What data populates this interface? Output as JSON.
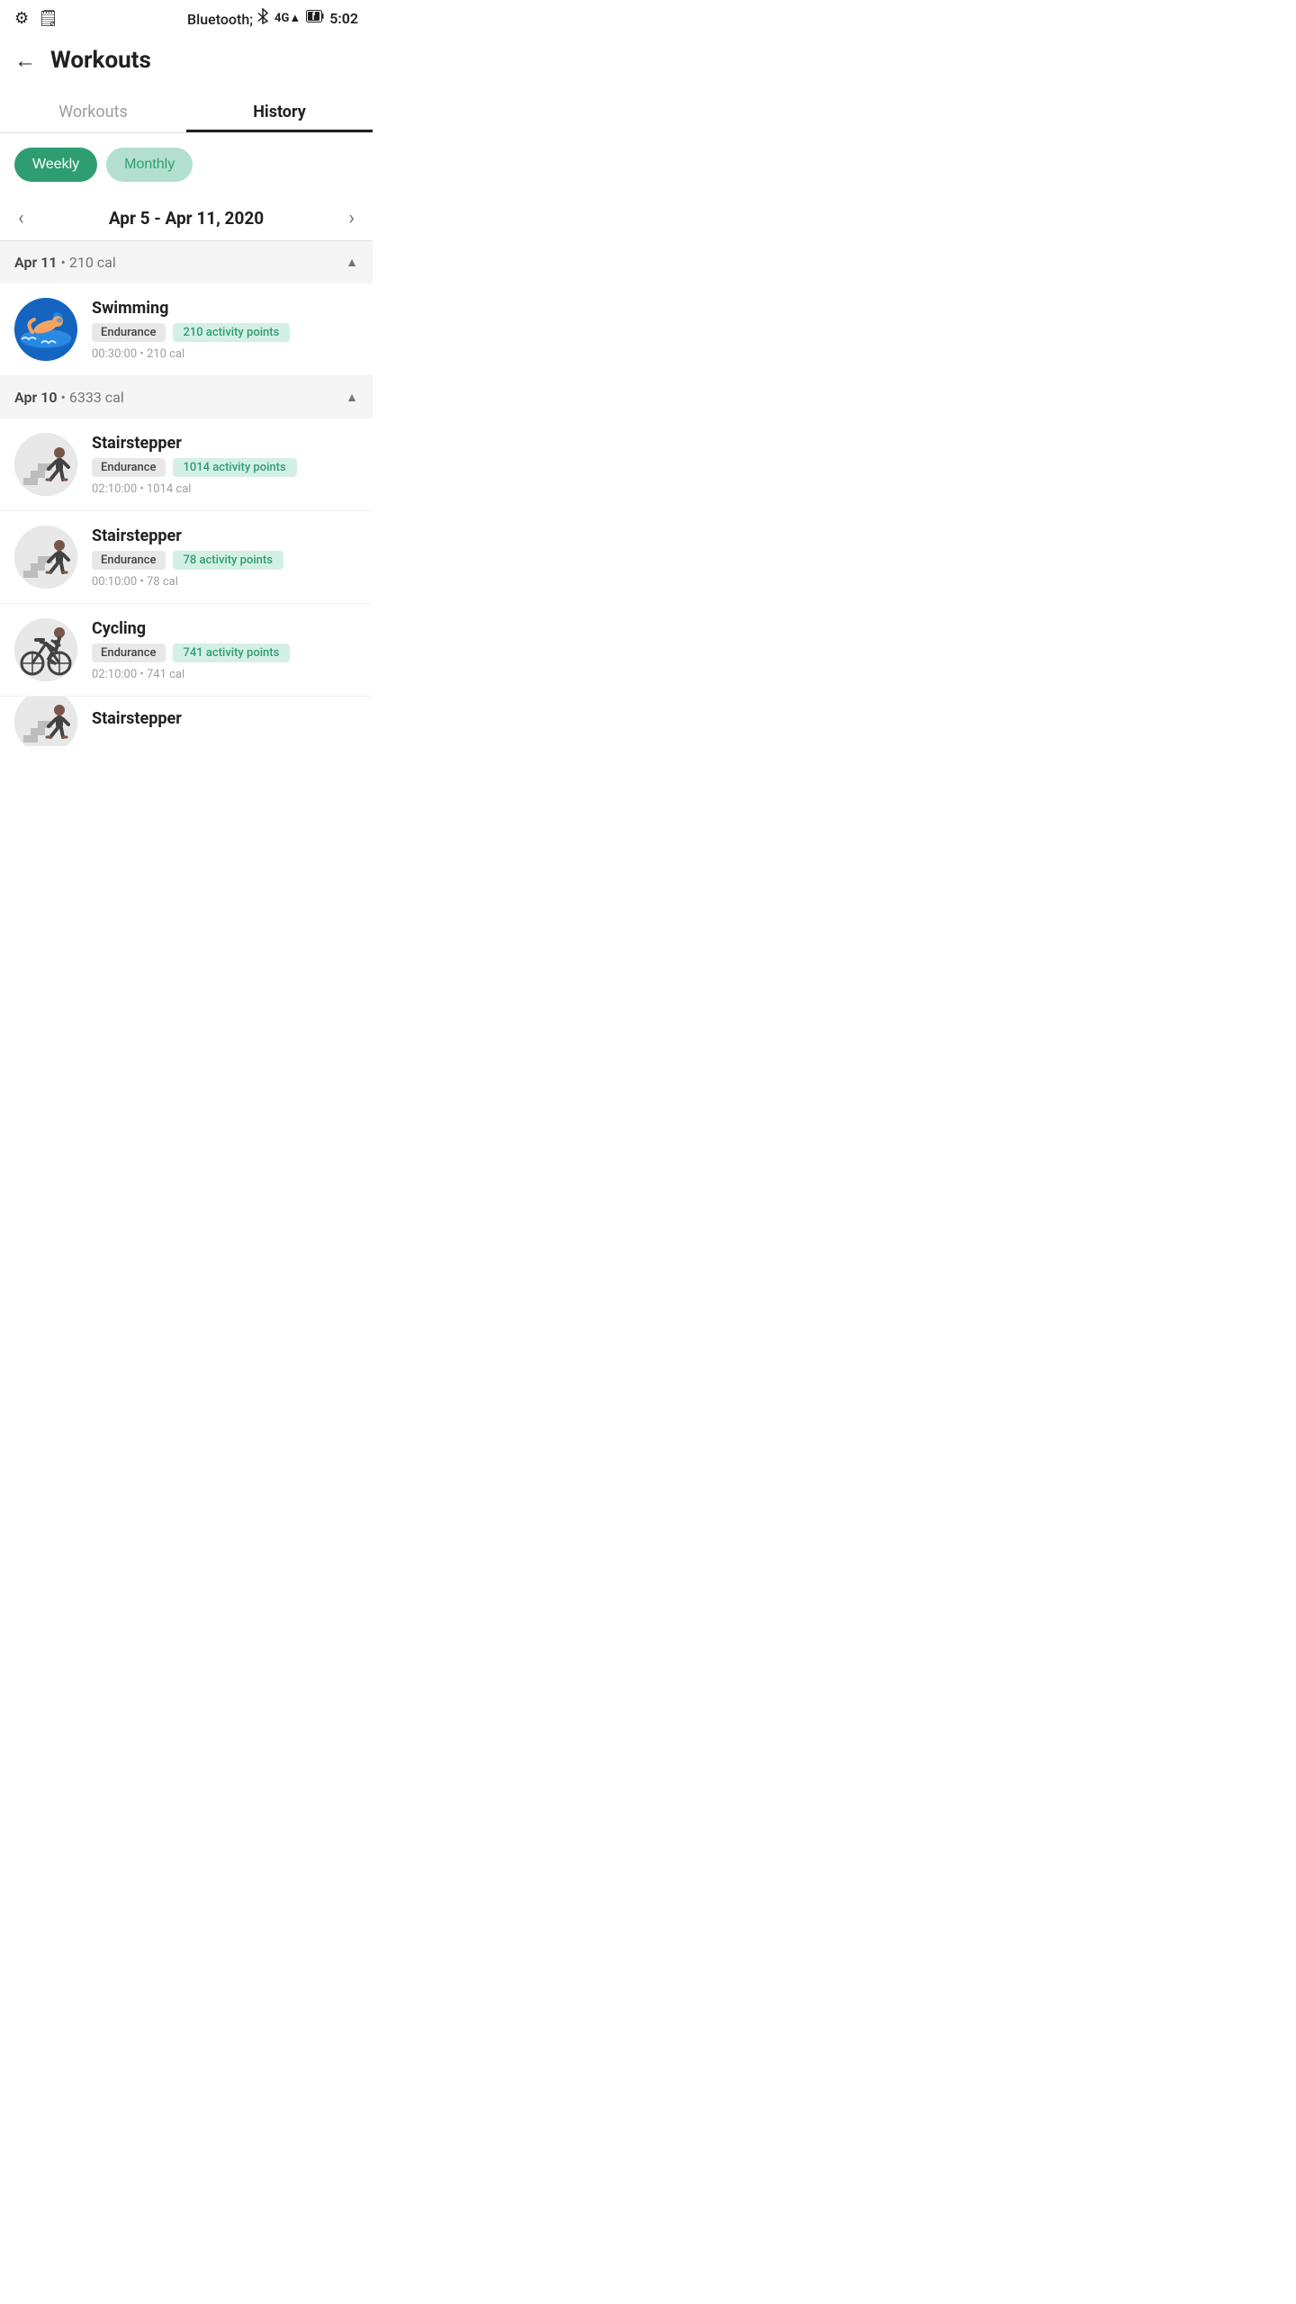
{
  "statusBar": {
    "time": "5:02",
    "icons": {
      "bluetooth": "BT",
      "signal4g": "4G",
      "battery": "⚡"
    }
  },
  "header": {
    "backLabel": "←",
    "title": "Workouts"
  },
  "tabs": [
    {
      "id": "workouts",
      "label": "Workouts",
      "active": false
    },
    {
      "id": "history",
      "label": "History",
      "active": true
    }
  ],
  "filters": [
    {
      "id": "weekly",
      "label": "Weekly",
      "active": true
    },
    {
      "id": "monthly",
      "label": "Monthly",
      "active": false
    }
  ],
  "dateRange": {
    "text": "Apr 5 - Apr 11, 2020",
    "prevArrow": "‹",
    "nextArrow": "›"
  },
  "dayGroups": [
    {
      "date": "Apr 11",
      "calories": "210 cal",
      "collapsed": false,
      "workouts": [
        {
          "name": "Swimming",
          "category": "Endurance",
          "activityPoints": "210 activity points",
          "duration": "00:30:00",
          "calories": "210 cal",
          "avatarType": "swimming"
        }
      ]
    },
    {
      "date": "Apr 10",
      "calories": "6333 cal",
      "collapsed": false,
      "workouts": [
        {
          "name": "Stairstepper",
          "category": "Endurance",
          "activityPoints": "1014 activity points",
          "duration": "02:10:00",
          "calories": "1014 cal",
          "avatarType": "stairstepper"
        },
        {
          "name": "Stairstepper",
          "category": "Endurance",
          "activityPoints": "78 activity points",
          "duration": "00:10:00",
          "calories": "78 cal",
          "avatarType": "stairstepper"
        },
        {
          "name": "Cycling",
          "category": "Endurance",
          "activityPoints": "741 activity points",
          "duration": "02:10:00",
          "calories": "741 cal",
          "avatarType": "cycling"
        },
        {
          "name": "Stairstepper",
          "category": "Endurance",
          "activityPoints": "",
          "duration": "",
          "calories": "",
          "avatarType": "stairstepper",
          "partial": true
        }
      ]
    }
  ]
}
